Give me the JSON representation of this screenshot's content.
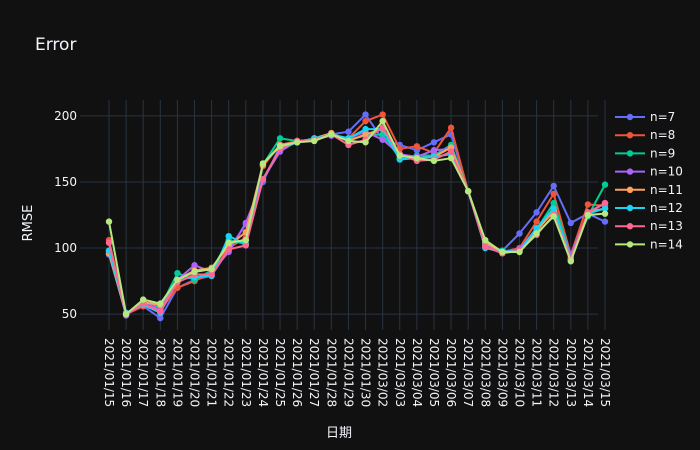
{
  "chart_data": {
    "type": "line",
    "title": "Error",
    "xlabel": "日期",
    "ylabel": "RMSE",
    "ylim": [
      38,
      212
    ],
    "yticks": [
      50,
      100,
      150,
      200
    ],
    "grid": true,
    "legend_position": "right",
    "categories": [
      "2021/01/15",
      "2021/01/16",
      "2021/01/17",
      "2021/01/18",
      "2021/01/19",
      "2021/01/20",
      "2021/01/21",
      "2021/01/22",
      "2021/01/23",
      "2021/01/24",
      "2021/01/25",
      "2021/01/26",
      "2021/01/27",
      "2021/01/28",
      "2021/01/29",
      "2021/01/30",
      "2021/03/02",
      "2021/03/03",
      "2021/03/04",
      "2021/03/05",
      "2021/03/06",
      "2021/03/07",
      "2021/03/08",
      "2021/03/09",
      "2021/03/10",
      "2021/03/11",
      "2021/03/12",
      "2021/03/13",
      "2021/03/14",
      "2021/03/15"
    ],
    "tick_labels": [
      "2021/01/15",
      "2021/01/16",
      "2021/01/17",
      "2021/01/18",
      "2021/01/19",
      "2021/01/20",
      "2021/01/21",
      "2021/01/22",
      "2021/01/23",
      "2021/01/24",
      "2021/01/25",
      "2021/01/26",
      "2021/01/27",
      "2021/01/28",
      "2021/01/29",
      "2021/01/30",
      "2021/03/02",
      "2021/03/03",
      "2021/03/04",
      "2021/03/05",
      "2021/03/06",
      "2021/03/07",
      "2021/03/08",
      "2021/03/09",
      "2021/03/10",
      "2021/03/11",
      "2021/03/12",
      "2021/03/13",
      "2021/03/14",
      "2021/03/15"
    ],
    "series": [
      {
        "name": "n=7",
        "color": "#636efa",
        "values": [
          95,
          50,
          56,
          47,
          70,
          76,
          79,
          99,
          118,
          150,
          177,
          180,
          182,
          186,
          188,
          201,
          182,
          178,
          174,
          180,
          186,
          143,
          102,
          98,
          111,
          127,
          147,
          119,
          126,
          120
        ]
      },
      {
        "name": "n=8",
        "color": "#ef553b",
        "values": [
          106,
          50,
          56,
          53,
          70,
          75,
          81,
          100,
          108,
          162,
          178,
          181,
          182,
          186,
          183,
          196,
          201,
          175,
          177,
          172,
          191,
          143,
          104,
          97,
          100,
          120,
          141,
          95,
          133,
          132
        ]
      },
      {
        "name": "n=9",
        "color": "#00cc96",
        "values": [
          98,
          50,
          59,
          55,
          81,
          76,
          83,
          106,
          103,
          163,
          183,
          181,
          182,
          186,
          182,
          185,
          186,
          168,
          170,
          170,
          178,
          143,
          102,
          98,
          98,
          114,
          134,
          94,
          124,
          148
        ]
      },
      {
        "name": "n=10",
        "color": "#ab63fa",
        "values": [
          97,
          49,
          60,
          53,
          76,
          87,
          82,
          97,
          119,
          152,
          173,
          181,
          182,
          185,
          183,
          188,
          182,
          171,
          169,
          174,
          175,
          143,
          103,
          97,
          99,
          115,
          127,
          95,
          126,
          134
        ]
      },
      {
        "name": "n=11",
        "color": "#ffa15a",
        "values": [
          96,
          50,
          59,
          57,
          76,
          83,
          85,
          102,
          112,
          163,
          178,
          180,
          183,
          187,
          181,
          186,
          190,
          170,
          168,
          169,
          176,
          143,
          104,
          97,
          98,
          113,
          128,
          91,
          127,
          130
        ]
      },
      {
        "name": "n=12",
        "color": "#19d3f3",
        "values": [
          98,
          51,
          57,
          51,
          76,
          78,
          79,
          109,
          103,
          152,
          175,
          180,
          183,
          186,
          183,
          190,
          190,
          167,
          168,
          169,
          171,
          143,
          100,
          97,
          98,
          115,
          130,
          92,
          126,
          130
        ]
      },
      {
        "name": "n=13",
        "color": "#ff6692",
        "values": [
          104,
          50,
          58,
          52,
          74,
          80,
          80,
          99,
          102,
          152,
          175,
          181,
          182,
          186,
          178,
          182,
          191,
          171,
          166,
          167,
          173,
          143,
          101,
          96,
          98,
          110,
          125,
          92,
          127,
          134
        ]
      },
      {
        "name": "n=14",
        "color": "#b6e880",
        "values": [
          120,
          50,
          61,
          58,
          76,
          82,
          84,
          104,
          106,
          164,
          177,
          180,
          181,
          186,
          181,
          180,
          196,
          170,
          168,
          166,
          168,
          143,
          106,
          97,
          97,
          111,
          124,
          90,
          125,
          126
        ]
      }
    ]
  }
}
